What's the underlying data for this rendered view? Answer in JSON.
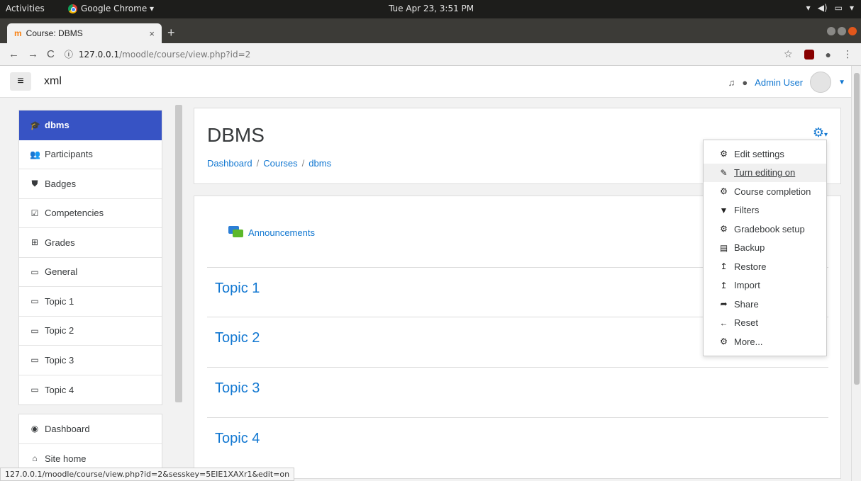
{
  "os": {
    "activities": "Activities",
    "app_name": "Google Chrome ▾",
    "clock": "Tue Apr 23,  3:51 PM",
    "tray": [
      "wifi-icon",
      "volume-icon",
      "battery-icon",
      "menu-arrow-icon"
    ]
  },
  "browser": {
    "tab_title": "Course: DBMS",
    "tab_favicon": "m",
    "url_host": "127.0.0.1",
    "url_path": "/moodle/course/view.php?id=2",
    "status_url": "127.0.0.1/moodle/course/view.php?id=2&sesskey=5EIE1XAXr1&edit=on"
  },
  "navbar": {
    "site_name": "xml",
    "user_name": "Admin User"
  },
  "drawer": {
    "course_items": [
      {
        "label": "dbms",
        "icon": "graduation-cap-icon",
        "active": true
      },
      {
        "label": "Participants",
        "icon": "users-icon"
      },
      {
        "label": "Badges",
        "icon": "shield-icon"
      },
      {
        "label": "Competencies",
        "icon": "check-square-icon"
      },
      {
        "label": "Grades",
        "icon": "table-icon"
      },
      {
        "label": "General",
        "icon": "folder-icon"
      },
      {
        "label": "Topic 1",
        "icon": "folder-icon"
      },
      {
        "label": "Topic 2",
        "icon": "folder-icon"
      },
      {
        "label": "Topic 3",
        "icon": "folder-icon"
      },
      {
        "label": "Topic 4",
        "icon": "folder-icon"
      }
    ],
    "site_items": [
      {
        "label": "Dashboard",
        "icon": "dashboard-icon"
      },
      {
        "label": "Site home",
        "icon": "home-icon"
      }
    ]
  },
  "course": {
    "title": "DBMS",
    "breadcrumb": [
      "Dashboard",
      "Courses",
      "dbms"
    ],
    "announcements": "Announcements",
    "sections": [
      "Topic 1",
      "Topic 2",
      "Topic 3",
      "Topic 4"
    ]
  },
  "settings_menu": [
    {
      "label": "Edit settings",
      "icon": "cog-icon"
    },
    {
      "label": "Turn editing on",
      "icon": "pencil-icon",
      "hover": true
    },
    {
      "label": "Course completion",
      "icon": "cog-icon"
    },
    {
      "label": "Filters",
      "icon": "filter-icon"
    },
    {
      "label": "Gradebook setup",
      "icon": "cog-icon"
    },
    {
      "label": "Backup",
      "icon": "file-archive-icon"
    },
    {
      "label": "Restore",
      "icon": "upload-icon"
    },
    {
      "label": "Import",
      "icon": "upload-icon"
    },
    {
      "label": "Share",
      "icon": "share-icon"
    },
    {
      "label": "Reset",
      "icon": "arrow-left-icon"
    },
    {
      "label": "More...",
      "icon": "cog-icon"
    }
  ]
}
